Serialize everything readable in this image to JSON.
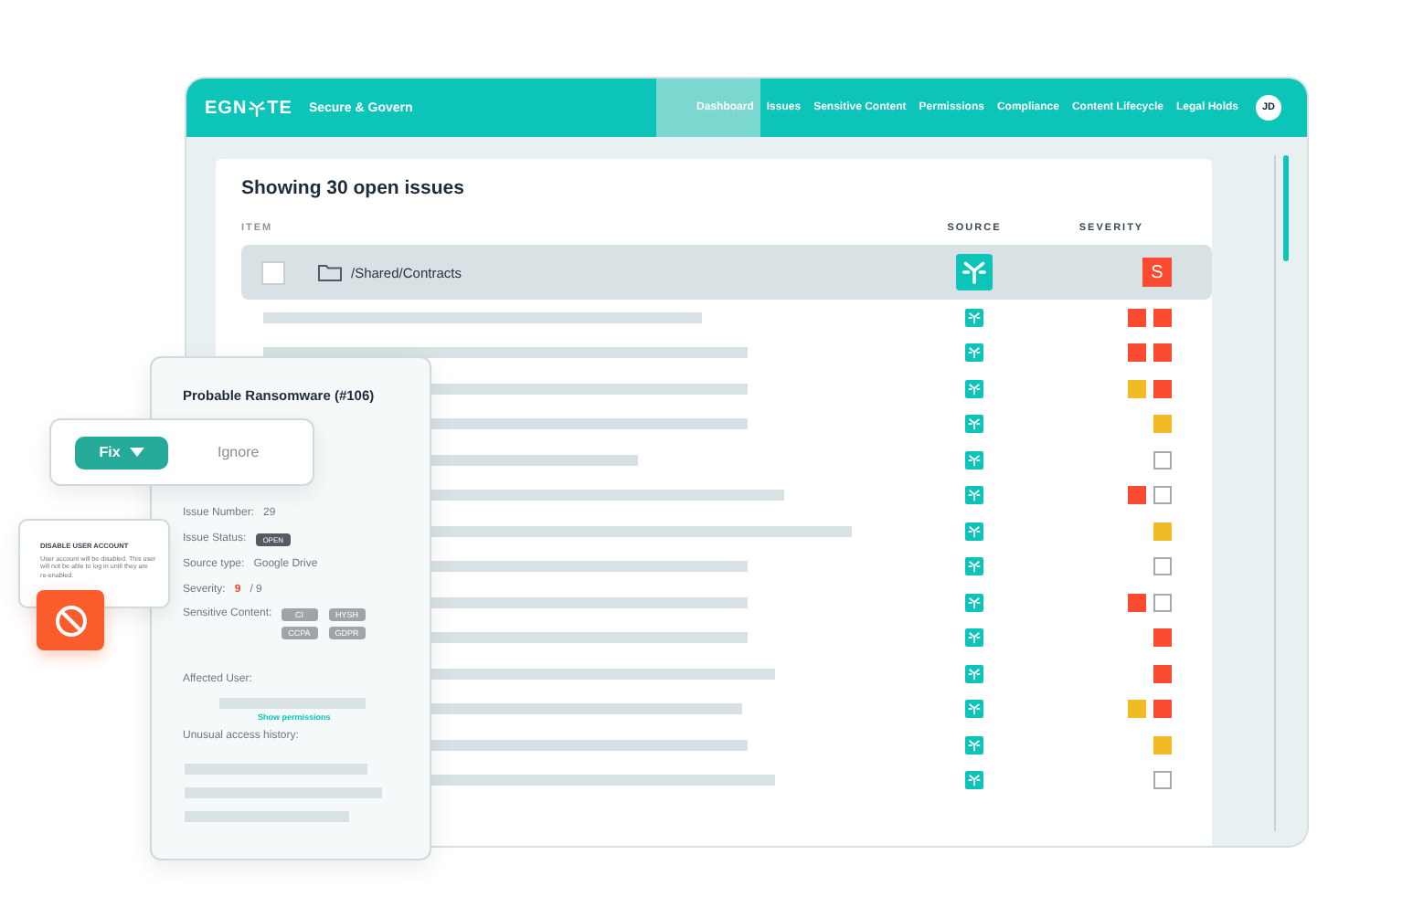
{
  "header": {
    "logo_left": "EGN",
    "logo_right": "TE",
    "product": "Secure & Govern",
    "nav": [
      {
        "label": "Dashboard",
        "selected": true
      },
      {
        "label": "Issues",
        "selected": false
      },
      {
        "label": "Sensitive Content",
        "selected": false
      },
      {
        "label": "Permissions",
        "selected": false
      },
      {
        "label": "Compliance",
        "selected": false
      },
      {
        "label": "Content Lifecycle",
        "selected": false
      },
      {
        "label": "Legal Holds",
        "selected": false
      }
    ],
    "avatar": "JD"
  },
  "table": {
    "title": "Showing 30 open issues",
    "columns": [
      "ITEM",
      "SOURCE",
      "SEVERITY"
    ],
    "selected_row": {
      "path": "/Shared/Contracts",
      "checked": false,
      "severity_letter": "S"
    },
    "rows": [
      {
        "severity": [
          {
            "kind": "filled",
            "color": "#fa4a2f"
          },
          {
            "kind": "filled",
            "color": "#fa4a2f"
          }
        ]
      },
      {
        "severity": [
          {
            "kind": "filled",
            "color": "#fa4a2f"
          },
          {
            "kind": "filled",
            "color": "#fa4a2f"
          }
        ]
      },
      {
        "severity": [
          {
            "kind": "filled",
            "color": "#f0bb24"
          },
          {
            "kind": "filled",
            "color": "#fa4a2f"
          }
        ]
      },
      {
        "severity": [
          {
            "kind": "filled",
            "color": "#f0bb24"
          }
        ]
      },
      {
        "severity": [
          {
            "kind": "outline"
          }
        ]
      },
      {
        "severity": [
          {
            "kind": "filled",
            "color": "#fa4a2f"
          },
          {
            "kind": "outline"
          }
        ]
      },
      {
        "severity": [
          {
            "kind": "filled",
            "color": "#f0bb24"
          }
        ]
      },
      {
        "severity": [
          {
            "kind": "outline"
          }
        ]
      },
      {
        "severity": [
          {
            "kind": "filled",
            "color": "#fa4a2f"
          },
          {
            "kind": "outline"
          }
        ]
      },
      {
        "severity": [
          {
            "kind": "filled",
            "color": "#fa4a2f"
          }
        ]
      },
      {
        "severity": [
          {
            "kind": "filled",
            "color": "#fa4a2f"
          }
        ]
      },
      {
        "severity": [
          {
            "kind": "filled",
            "color": "#f0bb24"
          },
          {
            "kind": "filled",
            "color": "#fa4a2f"
          }
        ]
      },
      {
        "severity": [
          {
            "kind": "filled",
            "color": "#f0bb24"
          }
        ]
      },
      {
        "severity": [
          {
            "kind": "outline"
          }
        ]
      }
    ]
  },
  "detail": {
    "title": "Probable Ransomware (#106)",
    "issue_number_label": "Issue Number:",
    "issue_number": "29",
    "status_label": "Issue Status:",
    "status": "OPEN",
    "source_label": "Source type:",
    "source": "Google Drive",
    "severity_label": "Severity:",
    "severity_score": "9",
    "severity_total": "/ 9",
    "content_label": "Sensitive Content:",
    "tags": [
      "CI",
      "HYSH",
      "CCPA",
      "GDPR"
    ],
    "affected_label": "Affected User:",
    "show_permissions": "Show permissions",
    "history_label": "Unusual access history:"
  },
  "actions": {
    "fix": "Fix",
    "ignore": "Ignore"
  },
  "disable_card": {
    "title": "DISABLE USER ACCOUNT",
    "text": "User account will be disabled. This user will not be able to log in until they are re-enabled."
  }
}
